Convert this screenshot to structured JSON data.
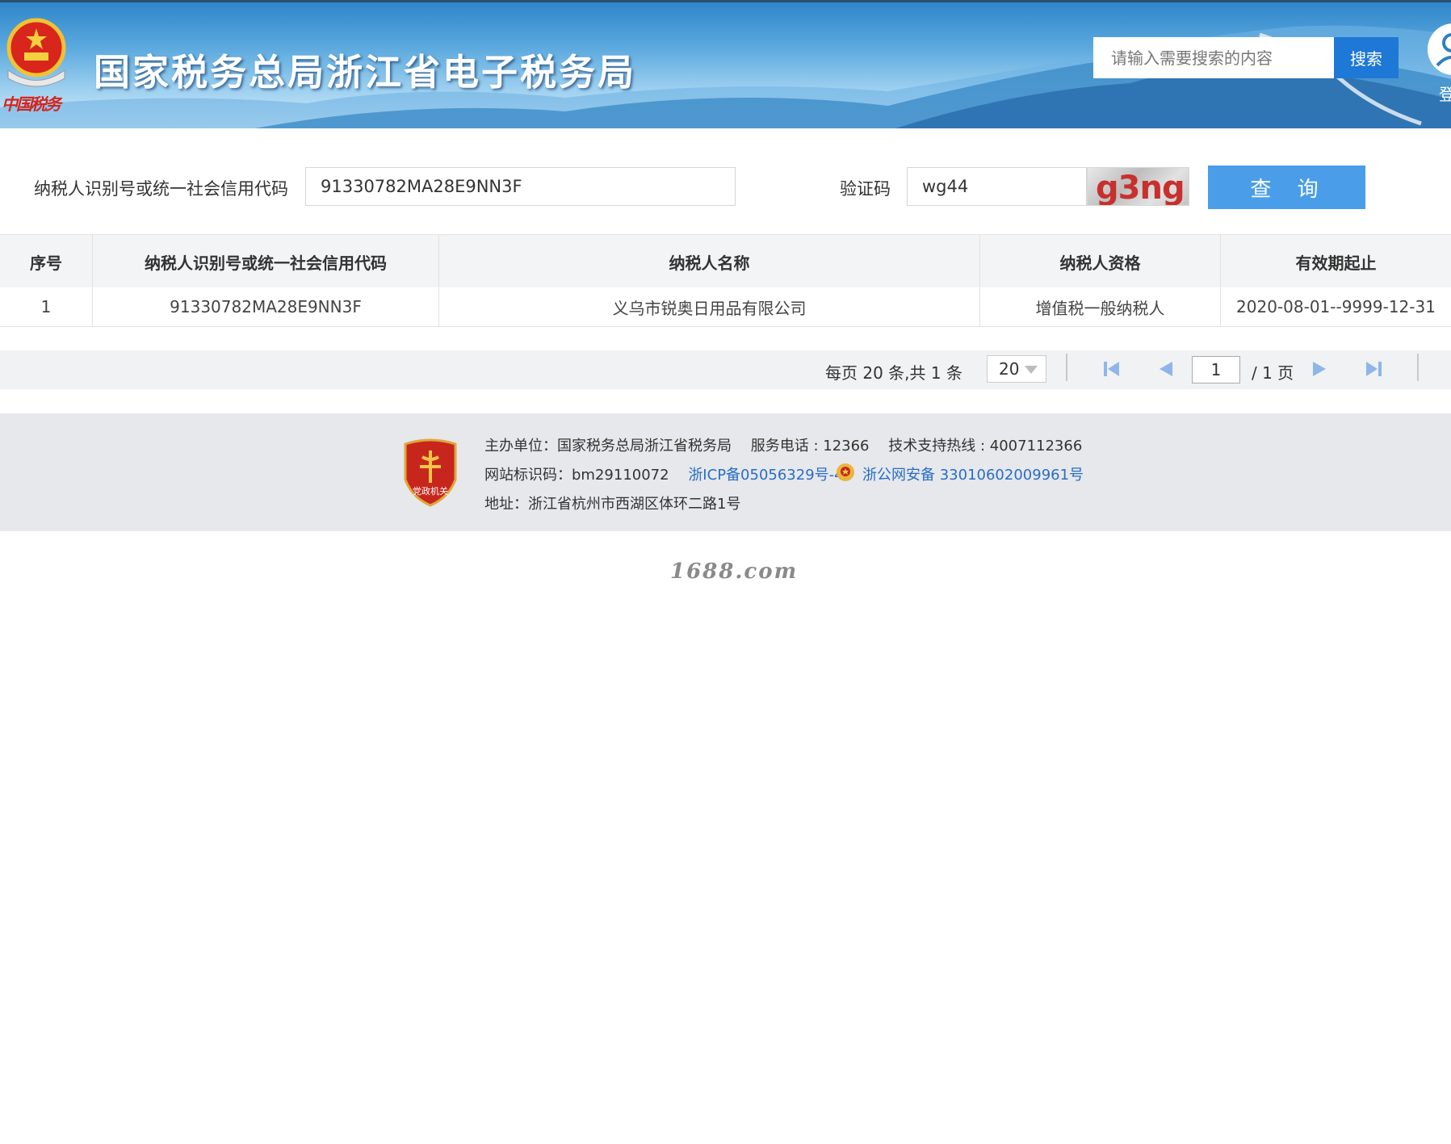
{
  "header": {
    "title": "国家税务总局浙江省电子税务局",
    "calligraphy": "中国税务",
    "search_placeholder": "请输入需要搜索的内容",
    "search_button": "搜索",
    "login_label": "登"
  },
  "query": {
    "taxpayer_id_label": "纳税人识别号或统一社会信用代码",
    "taxpayer_id_value": "91330782MA28E9NN3F",
    "captcha_label": "验证码",
    "captcha_value": "wg44",
    "captcha_image_text": "g3ng",
    "query_button": "查 询"
  },
  "table": {
    "columns": [
      "序号",
      "纳税人识别号或统一社会信用代码",
      "纳税人名称",
      "纳税人资格",
      "有效期起止"
    ],
    "rows": [
      [
        "1",
        "91330782MA28E9NN3F",
        "义乌市锐奥日用品有限公司",
        "增值税一般纳税人",
        "2020-08-01--9999-12-31"
      ]
    ]
  },
  "pagination": {
    "summary": "每页 20 条,共 1 条",
    "page_size": "20",
    "current_page": "1",
    "total_pages_text": "/ 1 页"
  },
  "footer": {
    "host": "主办单位：国家税务总局浙江省税务局",
    "phone": "服务电话 : 12366",
    "hotline": "技术支持热线 : 4007112366",
    "site_code": "网站标识码：bm29110072",
    "icp": "浙ICP备05056329号-4",
    "police_record": "浙公网安备 33010602009961号",
    "address": "地址：浙江省杭州市西湖区体环二路1号",
    "badge_text": "党政机关"
  },
  "watermark": "1688.com",
  "colors": {
    "query_button": "#4a9de8",
    "search_button": "#1e78d6",
    "link": "#2a6cc7",
    "captcha_text": "#c8302d"
  }
}
